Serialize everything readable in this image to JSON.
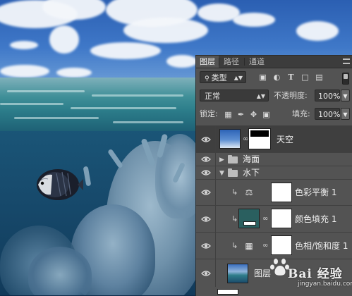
{
  "tabs": [
    {
      "label": "图层",
      "active": true
    },
    {
      "label": "路径",
      "active": false
    },
    {
      "label": "通道",
      "active": false
    }
  ],
  "filter": {
    "kind_label": "类型"
  },
  "blend": {
    "mode": "正常",
    "opacity_label": "不透明度:",
    "opacity_value": "100%"
  },
  "lock": {
    "label": "锁定:",
    "fill_label": "填充:",
    "fill_value": "100%"
  },
  "layers": [
    {
      "name": "天空",
      "type": "masked-image",
      "selected": true
    },
    {
      "name": "海面",
      "type": "group",
      "expanded": false
    },
    {
      "name": "水下",
      "type": "group",
      "expanded": true
    },
    {
      "name": "色彩平衡 1",
      "type": "adjustment",
      "icon": "balance-scale-icon",
      "clipped": true
    },
    {
      "name": "颜色填充 1",
      "type": "fill",
      "fill_color": "#2a5f5f",
      "clipped": true
    },
    {
      "name": "色相/饱和度 1",
      "type": "adjustment",
      "icon": "hue-saturation-icon",
      "clipped": true
    },
    {
      "name": "图层",
      "type": "image"
    }
  ],
  "watermark": {
    "text": "Bai 经验",
    "sub": "jingyan.baidu.com"
  },
  "colors": {
    "panel_bg": "#535353",
    "selected_row": "#3f3f3f",
    "tab_bar": "#3c3c3c"
  }
}
